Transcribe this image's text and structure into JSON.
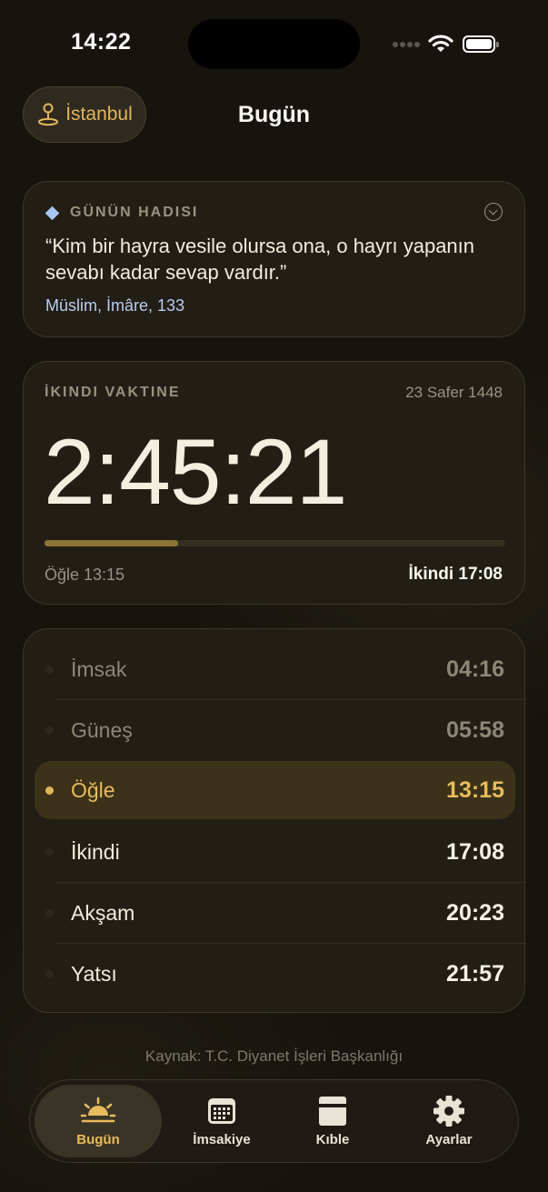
{
  "status": {
    "time": "14:22"
  },
  "header": {
    "location": "İstanbul",
    "title": "Bugün"
  },
  "hadith": {
    "heading": "GÜNÜN HADISI",
    "text": "“Kim bir hayra vesile olursa ona, o hayrı yapanın sevabı kadar sevap vardır.”",
    "source": "Müslim, İmâre, 133"
  },
  "countdown": {
    "label": "İKINDI VAKTINE",
    "hijri_date": "23 Safer 1448",
    "remaining": "2:45:21",
    "progress": 0.29,
    "start": "Öğle 13:15",
    "end": "İkindi 17:08"
  },
  "prayer_times": [
    {
      "name": "İmsak",
      "time": "04:16",
      "state": "past"
    },
    {
      "name": "Güneş",
      "time": "05:58",
      "state": "past"
    },
    {
      "name": "Öğle",
      "time": "13:15",
      "state": "active"
    },
    {
      "name": "İkindi",
      "time": "17:08",
      "state": "upcoming"
    },
    {
      "name": "Akşam",
      "time": "20:23",
      "state": "upcoming"
    },
    {
      "name": "Yatsı",
      "time": "21:57",
      "state": "upcoming"
    }
  ],
  "footer": {
    "source": "Kaynak: T.C. Diyanet İşleri Başkanlığı"
  },
  "tabs": [
    {
      "label": "Bugün",
      "icon": "sunrise-icon",
      "active": true
    },
    {
      "label": "İmsakiye",
      "icon": "calendar-icon",
      "active": false
    },
    {
      "label": "Kıble",
      "icon": "qibla-icon",
      "active": false
    },
    {
      "label": "Ayarlar",
      "icon": "gear-icon",
      "active": false
    }
  ],
  "colors": {
    "accent": "#E8BB5D",
    "background": "#17140E",
    "card": "#221E16",
    "hadith_source": "#B8CDF0"
  }
}
